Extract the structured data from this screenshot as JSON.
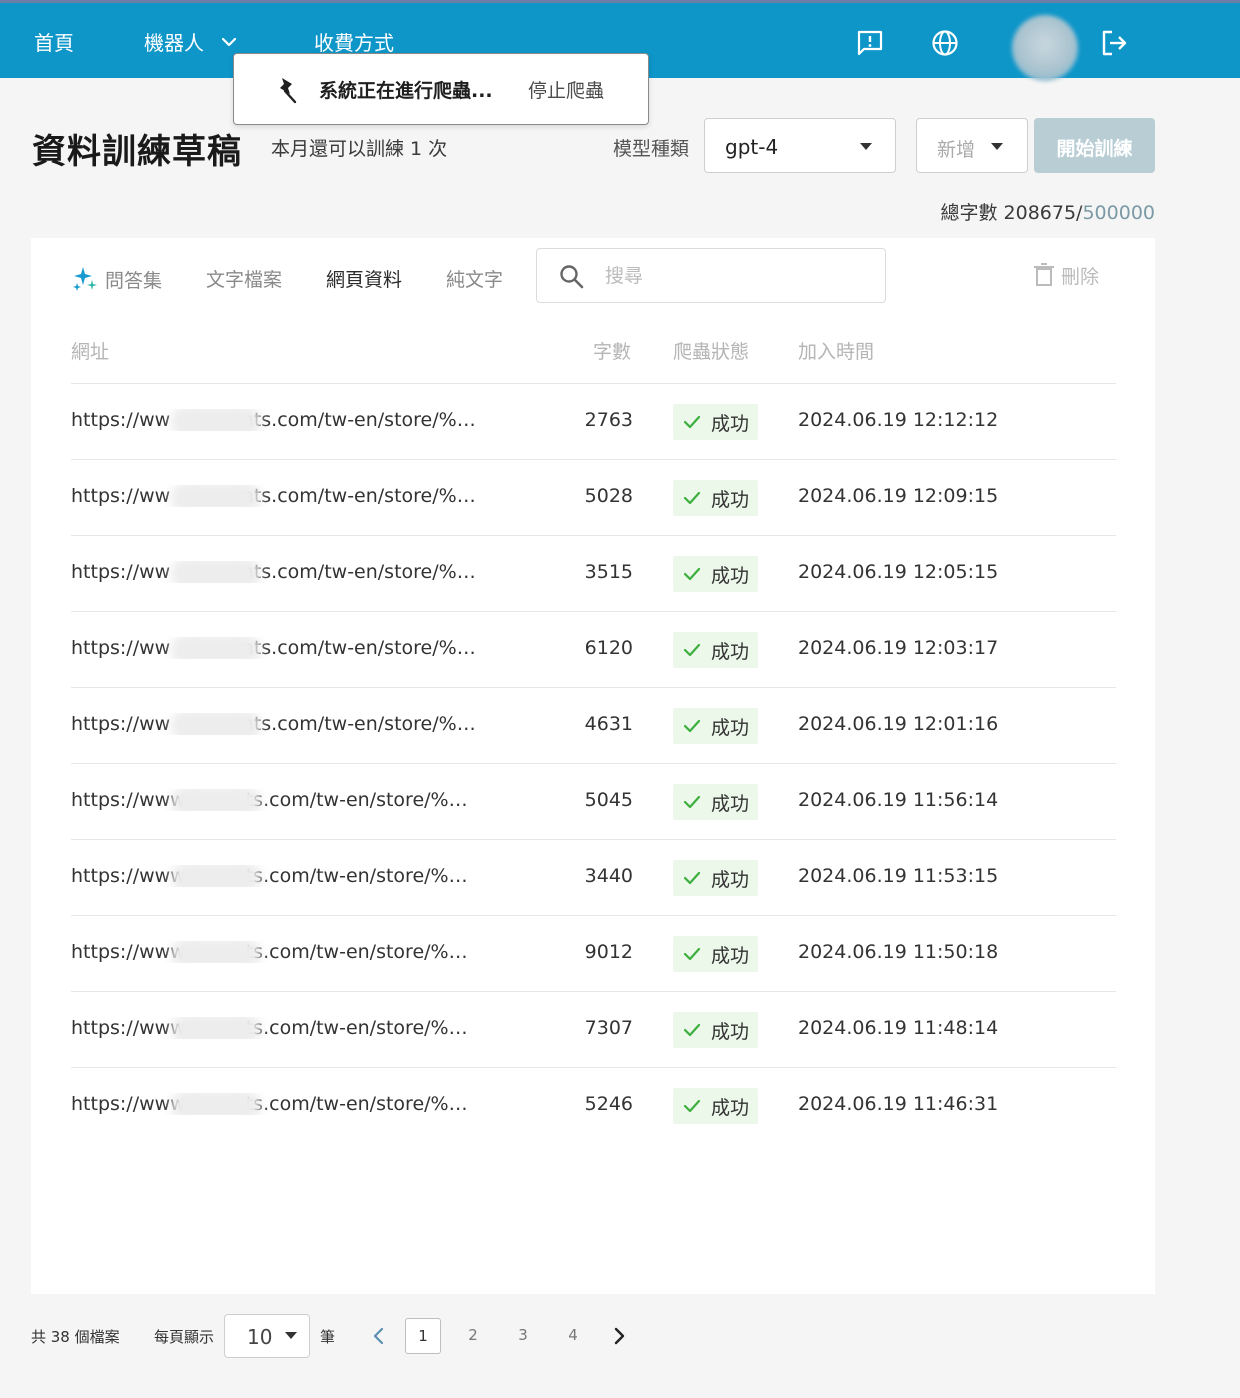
{
  "nav": {
    "home": "首頁",
    "robots": "機器人",
    "pricing": "收費方式",
    "icons": [
      "feedback-icon",
      "globe-icon",
      "logout-icon"
    ],
    "color": "#0e96c9"
  },
  "crawl_popup": {
    "message": "系統正在進行爬蟲...",
    "stop_label": "停止爬蟲"
  },
  "header": {
    "title": "資料訓練草稿",
    "quota": "本月還可以訓練 1 次",
    "model_label": "模型種類",
    "model_value": "gpt-4",
    "add_label": "新增",
    "start_label": "開始訓練",
    "char_count_label": "總字數 208675/",
    "char_count_limit": "500000"
  },
  "tabs": [
    {
      "label": "問答集"
    },
    {
      "label": "文字檔案"
    },
    {
      "label": "網頁資料"
    },
    {
      "label": "純文字"
    }
  ],
  "search": {
    "placeholder": "搜尋"
  },
  "delete_label": "刪除",
  "table": {
    "headers": [
      "網址",
      "字數",
      "爬蟲狀態",
      "加入時間"
    ],
    "rows": [
      {
        "url_prefix": "https://ww",
        "url_suffix": "ats.com/tw-en/store/%…",
        "count": "2763",
        "status": "成功",
        "time": "2024.06.19 12:12:12"
      },
      {
        "url_prefix": "https://ww",
        "url_suffix": "ats.com/tw-en/store/%…",
        "count": "5028",
        "status": "成功",
        "time": "2024.06.19 12:09:15"
      },
      {
        "url_prefix": "https://ww",
        "url_suffix": "ats.com/tw-en/store/%…",
        "count": "3515",
        "status": "成功",
        "time": "2024.06.19 12:05:15"
      },
      {
        "url_prefix": "https://ww",
        "url_suffix": "ats.com/tw-en/store/%…",
        "count": "6120",
        "status": "成功",
        "time": "2024.06.19 12:03:17"
      },
      {
        "url_prefix": "https://ww",
        "url_suffix": "ats.com/tw-en/store/%…",
        "count": "4631",
        "status": "成功",
        "time": "2024.06.19 12:01:16"
      },
      {
        "url_prefix": "https://www",
        "url_suffix": "ts.com/tw-en/store/%…",
        "count": "5045",
        "status": "成功",
        "time": "2024.06.19 11:56:14"
      },
      {
        "url_prefix": "https://www",
        "url_suffix": "ts.com/tw-en/store/%…",
        "count": "3440",
        "status": "成功",
        "time": "2024.06.19 11:53:15"
      },
      {
        "url_prefix": "https://www",
        "url_suffix": "ts.com/tw-en/store/%…",
        "count": "9012",
        "status": "成功",
        "time": "2024.06.19 11:50:18"
      },
      {
        "url_prefix": "https://www",
        "url_suffix": "ts.com/tw-en/store/%…",
        "count": "7307",
        "status": "成功",
        "time": "2024.06.19 11:48:14"
      },
      {
        "url_prefix": "https://www",
        "url_suffix": "ts.com/tw-en/store/%…",
        "count": "5246",
        "status": "成功",
        "time": "2024.06.19 11:46:31"
      }
    ]
  },
  "footer": {
    "total": "共 38 個檔案",
    "per_page_label": "每頁顯示",
    "per_page_value": "10",
    "unit": "筆",
    "pages": [
      "1",
      "2",
      "3",
      "4"
    ],
    "current_page": "1"
  },
  "colors": {
    "accent": "#0e96c9",
    "success_bg": "#ecf8ea",
    "success_check": "#3cae3c",
    "start_button": "#b9cdd5"
  }
}
